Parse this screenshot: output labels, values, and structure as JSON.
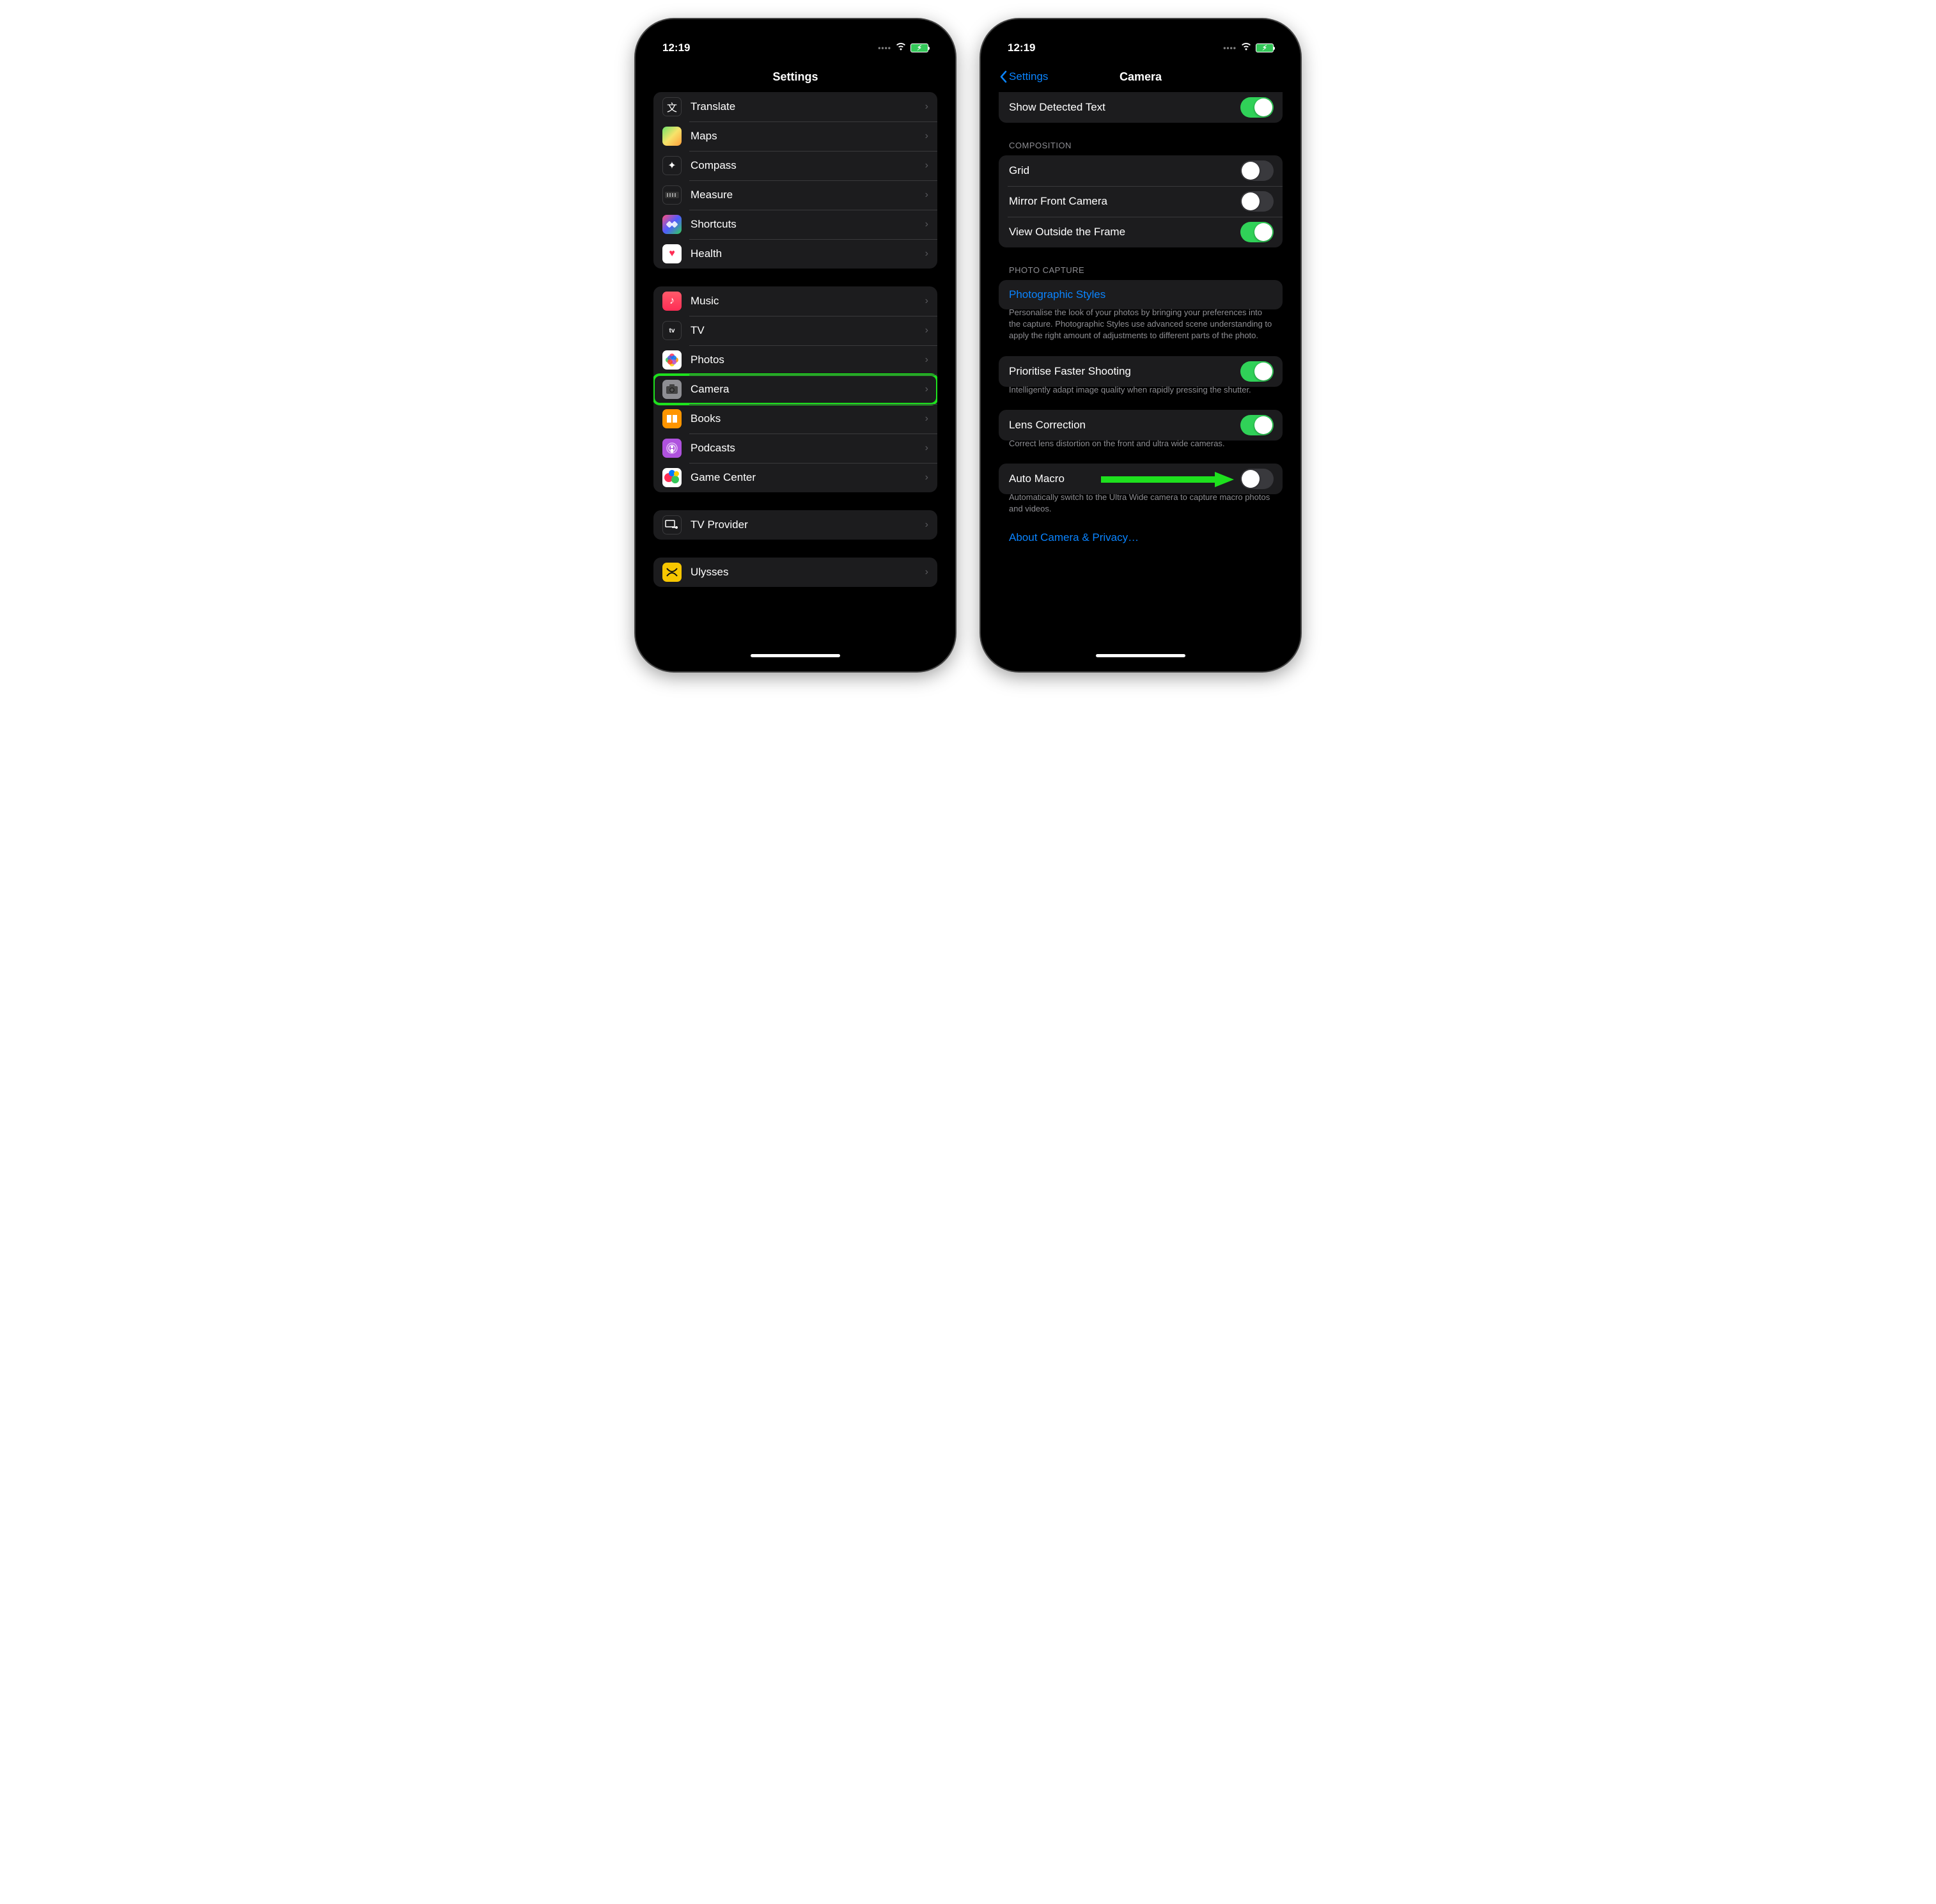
{
  "status": {
    "time": "12:19"
  },
  "left": {
    "title": "Settings",
    "group1": [
      {
        "label": "Translate",
        "icon": "translate"
      },
      {
        "label": "Maps",
        "icon": "maps"
      },
      {
        "label": "Compass",
        "icon": "compass"
      },
      {
        "label": "Measure",
        "icon": "measure"
      },
      {
        "label": "Shortcuts",
        "icon": "shortcuts"
      },
      {
        "label": "Health",
        "icon": "health"
      }
    ],
    "group2": [
      {
        "label": "Music",
        "icon": "music"
      },
      {
        "label": "TV",
        "icon": "tv"
      },
      {
        "label": "Photos",
        "icon": "photos"
      },
      {
        "label": "Camera",
        "icon": "camera",
        "highlighted": true
      },
      {
        "label": "Books",
        "icon": "books"
      },
      {
        "label": "Podcasts",
        "icon": "podcasts"
      },
      {
        "label": "Game Center",
        "icon": "gamecenter"
      }
    ],
    "group3": [
      {
        "label": "TV Provider",
        "icon": "tvprovider"
      }
    ],
    "group4": [
      {
        "label": "Ulysses",
        "icon": "ulysses"
      }
    ]
  },
  "right": {
    "back": "Settings",
    "title": "Camera",
    "top_row": {
      "label": "Show Detected Text",
      "on": true
    },
    "composition_header": "COMPOSITION",
    "composition": [
      {
        "label": "Grid",
        "on": false
      },
      {
        "label": "Mirror Front Camera",
        "on": false
      },
      {
        "label": "View Outside the Frame",
        "on": true
      }
    ],
    "photo_capture_header": "PHOTO CAPTURE",
    "photographic_styles": "Photographic Styles",
    "photographic_styles_desc": "Personalise the look of your photos by bringing your preferences into the capture. Photographic Styles use advanced scene understanding to apply the right amount of adjustments to different parts of the photo.",
    "prioritise": {
      "label": "Prioritise Faster Shooting",
      "on": true
    },
    "prioritise_desc": "Intelligently adapt image quality when rapidly pressing the shutter.",
    "lens": {
      "label": "Lens Correction",
      "on": true
    },
    "lens_desc": "Correct lens distortion on the front and ultra wide cameras.",
    "auto_macro": {
      "label": "Auto Macro",
      "on": false
    },
    "auto_macro_desc": "Automatically switch to the Ultra Wide camera to capture macro photos and videos.",
    "about_link": "About Camera & Privacy…"
  }
}
